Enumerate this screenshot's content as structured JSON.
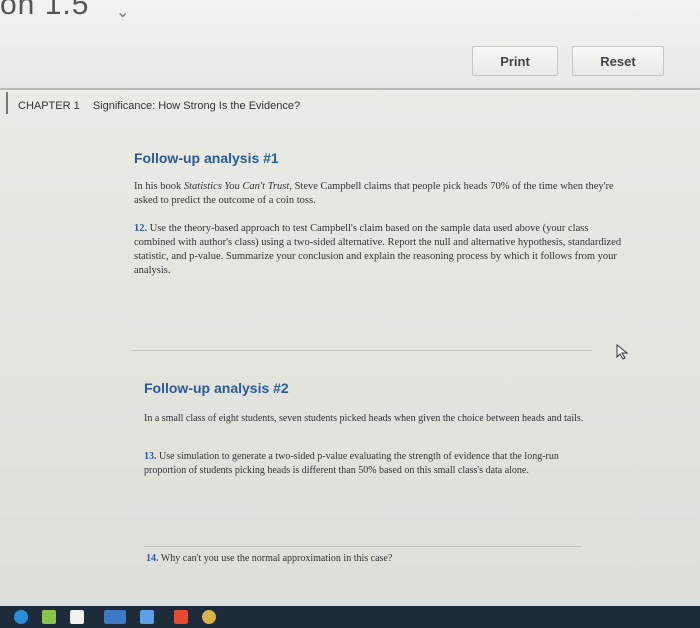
{
  "section": {
    "title": "on 1.5"
  },
  "buttons": {
    "print": "Print",
    "reset": "Reset"
  },
  "chapter": {
    "label": "CHAPTER 1",
    "title": "Significance: How Strong Is the Evidence?"
  },
  "followup1": {
    "heading": "Follow-up analysis #1",
    "intro_part1": "In his book ",
    "intro_book": "Statistics You Can't Trust",
    "intro_part2": ", Steve Campbell claims that people pick heads 70% of the time when they're asked to predict the outcome of a coin toss.",
    "q12_num": "12.",
    "q12_text": "Use the theory-based approach to test Campbell's claim based on the sample data used above (your class combined with author's class) using a two-sided alternative. Report the null and alternative hypothesis, standardized statistic, and p-value. Summarize your conclusion and explain the reasoning process by which it follows from your analysis."
  },
  "followup2": {
    "heading": "Follow-up analysis #2",
    "intro": "In a small class of eight students, seven students picked heads when given the choice between heads and tails.",
    "q13_num": "13.",
    "q13_text": "Use simulation to generate a two-sided p-value evaluating the strength of evidence that the long-run proportion of students picking heads is different than 50% based on this small class's data alone.",
    "q14_num": "14.",
    "q14_text": "Why can't you use the normal approximation in this case?"
  },
  "taskbar": {
    "icons": [
      "edge-icon",
      "app-icon",
      "store-icon",
      "cloud-icon",
      "dropbox-icon",
      "office-icon",
      "app2-icon"
    ]
  },
  "colors": {
    "heading": "#2a5a98",
    "qnum": "#2f5f9a"
  }
}
